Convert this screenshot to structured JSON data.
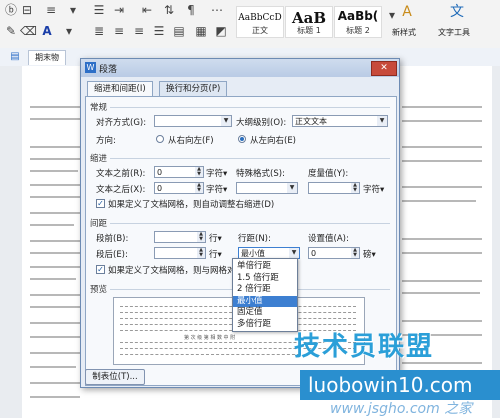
{
  "ribbon": {
    "styles": [
      {
        "sample": "AaBbCcD",
        "name": "正文"
      },
      {
        "sample": "AaB",
        "name": "标题 1"
      },
      {
        "sample": "AaBb(",
        "name": "标题 2"
      }
    ],
    "new_style_label": "新样式",
    "text_tools_label": "文字工具"
  },
  "doc": {
    "tab_label": "期末物"
  },
  "dialog": {
    "title": "段落",
    "close_glyph": "✕",
    "tabs": [
      "缩进和间距(I)",
      "换行和分页(P)"
    ],
    "general": {
      "section": "常规",
      "align_label": "对齐方式(G):",
      "align_value": "",
      "outline_label": "大纲级别(O):",
      "outline_value": "正文文本",
      "direction_label": "方向:",
      "rtl_label": "从右向左(F)",
      "ltr_label": "从左向右(E)"
    },
    "indent": {
      "section": "缩进",
      "before_label": "文本之前(R):",
      "before_value": "0",
      "after_label": "文本之后(X):",
      "after_value": "0",
      "unit": "字符▾",
      "special_label": "特殊格式(S):",
      "special_value": "",
      "measure_label": "度量值(Y):",
      "measure_unit": "字符▾",
      "grid_check": "如果定义了文档网格，则自动调整右缩进(D)"
    },
    "spacing": {
      "section": "间距",
      "before_label": "段前(B):",
      "after_label": "段后(E):",
      "line_unit": "行▾",
      "linespace_label": "行距(N):",
      "linespace_value": "最小值",
      "setting_label": "设置值(A):",
      "setting_value": "0",
      "setting_unit": "磅▾",
      "grid_check": "如果定义了文档网格，则与网格对"
    },
    "preview_section": "预览",
    "preview_text": "第 次 级 第 相 数 中 附",
    "tabs_button": "制表位(T)..."
  },
  "linespace_options": [
    "单倍行距",
    "1.5 倍行距",
    "2 倍行距",
    "最小值",
    "固定值",
    "多倍行距"
  ],
  "linespace_selected_index": 3,
  "watermark": {
    "main": "技术员联盟",
    "url": "luobowin10.com",
    "sub": "www.jsgho.com 之家"
  }
}
